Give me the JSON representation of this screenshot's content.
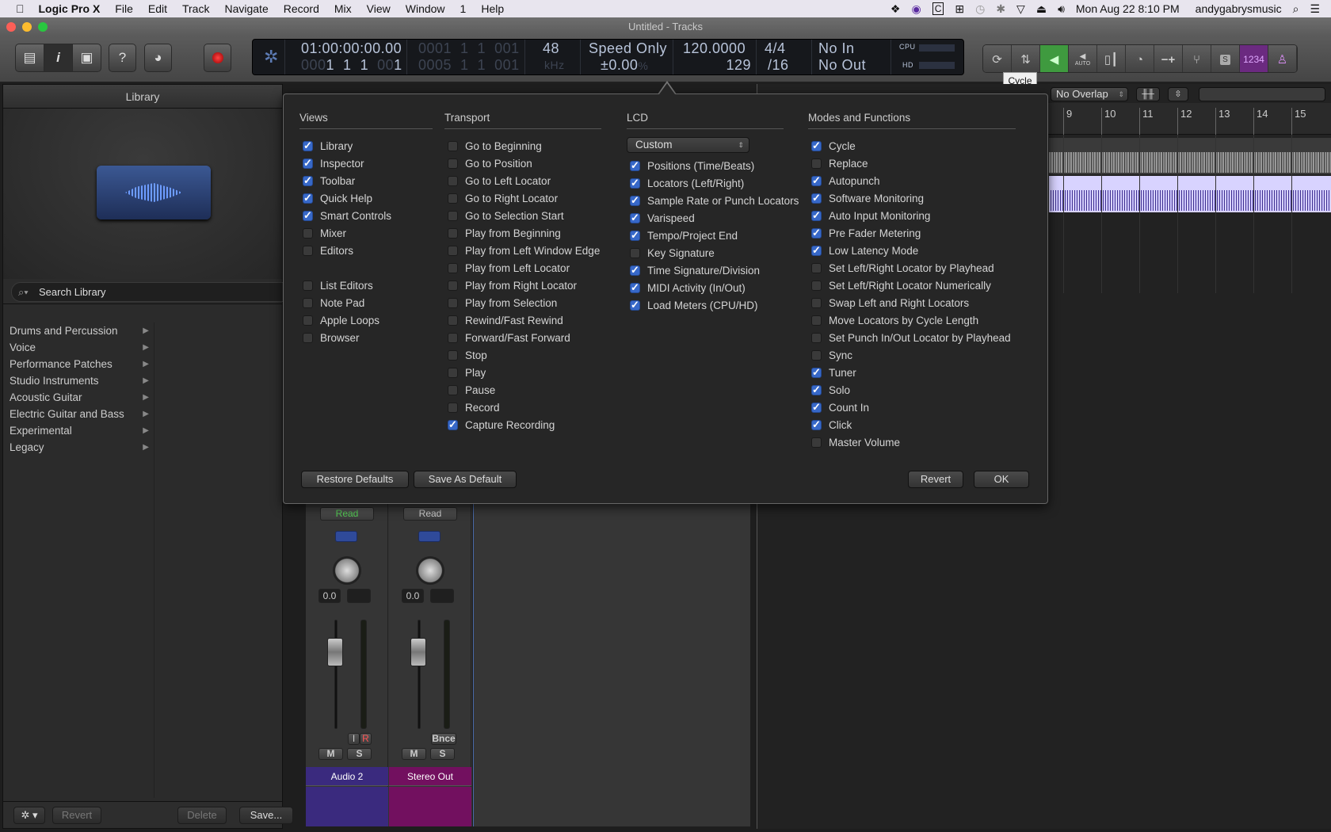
{
  "menubar": {
    "app": "Logic Pro X",
    "items": [
      "File",
      "Edit",
      "Track",
      "Navigate",
      "Record",
      "Mix",
      "View",
      "Window",
      "1",
      "Help"
    ],
    "datetime": "Mon Aug 22  8:10 PM",
    "user": "andygabrysmusic"
  },
  "window": {
    "title": "Untitled - Tracks"
  },
  "lcd": {
    "smpte": "01:00:00:00.00",
    "bars_dim": "000",
    "bars": "1  1  1  ",
    "bars_end_dim": "00",
    "bars_end": "1",
    "left_locator": "0001  1  1  001",
    "right_locator": "0005  1  1  001",
    "sample_rate": "48",
    "sample_rate_unit": "kHz",
    "varispeed_mode": "Speed Only",
    "varispeed_value": "±0.00",
    "varispeed_unit": "%",
    "tempo": "120.0000",
    "project_end": "129",
    "time_signature": "4/4",
    "division": "/16",
    "midi_in": "No In",
    "midi_out": "No Out",
    "cpu_label": "CPU",
    "hd_label": "HD"
  },
  "right_toolbar": {
    "count_in_label": "1234",
    "auto_label": "AUTO",
    "solo_label": "S",
    "minus_plus": "−+"
  },
  "tooltip": "Cycle",
  "library": {
    "title": "Library",
    "search_placeholder": "Search Library",
    "categories": [
      "Drums and Percussion",
      "Voice",
      "Performance Patches",
      "Studio Instruments",
      "Acoustic Guitar",
      "Electric Guitar and Bass",
      "Experimental",
      "Legacy"
    ],
    "revert": "Revert",
    "delete": "Delete",
    "save": "Save..."
  },
  "arrange": {
    "drag_mode": "No Overlap",
    "bars": [
      "9",
      "10",
      "11",
      "12",
      "13",
      "14",
      "15"
    ]
  },
  "mixer": {
    "strips": [
      {
        "automation": "Read",
        "pan_value": "0.0",
        "name": "Audio 2",
        "color": "#3a2a7e",
        "input": "I",
        "record": "R",
        "mute": "M",
        "solo": "S"
      },
      {
        "automation": "Read",
        "pan_value": "0.0",
        "name": "Stereo Out",
        "color": "#72105f",
        "bounce": "Bnce",
        "mute": "M",
        "solo": "S"
      }
    ]
  },
  "dialog": {
    "views": {
      "title": "Views",
      "items": [
        {
          "label": "Library",
          "checked": true
        },
        {
          "label": "Inspector",
          "checked": true
        },
        {
          "label": "Toolbar",
          "checked": true
        },
        {
          "label": "Quick Help",
          "checked": true
        },
        {
          "label": "Smart Controls",
          "checked": true
        },
        {
          "label": "Mixer",
          "checked": false
        },
        {
          "label": "Editors",
          "checked": false
        },
        {
          "label": "",
          "checked": null
        },
        {
          "label": "List Editors",
          "checked": false
        },
        {
          "label": "Note Pad",
          "checked": false
        },
        {
          "label": "Apple Loops",
          "checked": false
        },
        {
          "label": "Browser",
          "checked": false
        }
      ]
    },
    "transport": {
      "title": "Transport",
      "items": [
        {
          "label": "Go to Beginning",
          "checked": false
        },
        {
          "label": "Go to Position",
          "checked": false
        },
        {
          "label": "Go to Left Locator",
          "checked": false
        },
        {
          "label": "Go to Right Locator",
          "checked": false
        },
        {
          "label": "Go to Selection Start",
          "checked": false
        },
        {
          "label": "Play from Beginning",
          "checked": false
        },
        {
          "label": "Play from Left Window Edge",
          "checked": false
        },
        {
          "label": "Play from Left Locator",
          "checked": false
        },
        {
          "label": "Play from Right Locator",
          "checked": false
        },
        {
          "label": "Play from Selection",
          "checked": false
        },
        {
          "label": "Rewind/Fast Rewind",
          "checked": false
        },
        {
          "label": "Forward/Fast Forward",
          "checked": false
        },
        {
          "label": "Stop",
          "checked": false
        },
        {
          "label": "Play",
          "checked": false
        },
        {
          "label": "Pause",
          "checked": false
        },
        {
          "label": "Record",
          "checked": false
        },
        {
          "label": "Capture Recording",
          "checked": true
        }
      ]
    },
    "lcd": {
      "title": "LCD",
      "mode": "Custom",
      "items": [
        {
          "label": "Positions (Time/Beats)",
          "checked": true
        },
        {
          "label": "Locators (Left/Right)",
          "checked": true
        },
        {
          "label": "Sample Rate or Punch Locators",
          "checked": true
        },
        {
          "label": "Varispeed",
          "checked": true
        },
        {
          "label": "Tempo/Project End",
          "checked": true
        },
        {
          "label": "Key Signature",
          "checked": false
        },
        {
          "label": "Time Signature/Division",
          "checked": true
        },
        {
          "label": "MIDI Activity (In/Out)",
          "checked": true
        },
        {
          "label": "Load Meters (CPU/HD)",
          "checked": true
        }
      ]
    },
    "modes": {
      "title": "Modes and Functions",
      "items": [
        {
          "label": "Cycle",
          "checked": true
        },
        {
          "label": "Replace",
          "checked": false
        },
        {
          "label": "Autopunch",
          "checked": true
        },
        {
          "label": "Software Monitoring",
          "checked": true
        },
        {
          "label": "Auto Input Monitoring",
          "checked": true
        },
        {
          "label": "Pre Fader Metering",
          "checked": true
        },
        {
          "label": "Low Latency Mode",
          "checked": true
        },
        {
          "label": "Set Left/Right Locator by Playhead",
          "checked": false
        },
        {
          "label": "Set Left/Right Locator Numerically",
          "checked": false
        },
        {
          "label": "Swap Left and Right Locators",
          "checked": false
        },
        {
          "label": "Move Locators by Cycle Length",
          "checked": false
        },
        {
          "label": "Set Punch In/Out Locator by Playhead",
          "checked": false
        },
        {
          "label": "Sync",
          "checked": false
        },
        {
          "label": "Tuner",
          "checked": true
        },
        {
          "label": "Solo",
          "checked": true
        },
        {
          "label": "Count In",
          "checked": true
        },
        {
          "label": "Click",
          "checked": true
        },
        {
          "label": "Master Volume",
          "checked": false
        }
      ]
    },
    "buttons": {
      "restore": "Restore Defaults",
      "save_default": "Save As Default",
      "revert": "Revert",
      "ok": "OK"
    }
  },
  "colors": {
    "checkbox": "#3768c8",
    "monitor_active": "#3f9a3f",
    "count_in": "#6b2a80",
    "region_track2": "#d8d3ff",
    "region_wave2": "#3e2f8f",
    "region_wave1": "#8a8a8a"
  }
}
